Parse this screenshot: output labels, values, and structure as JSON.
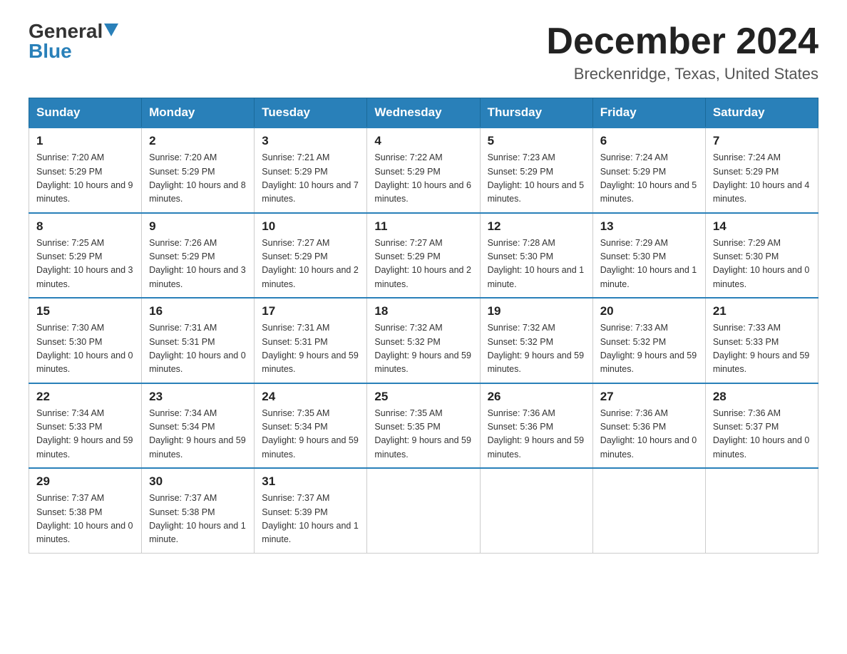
{
  "header": {
    "logo_general": "General",
    "logo_blue": "Blue",
    "month_title": "December 2024",
    "location": "Breckenridge, Texas, United States"
  },
  "days_of_week": [
    "Sunday",
    "Monday",
    "Tuesday",
    "Wednesday",
    "Thursday",
    "Friday",
    "Saturday"
  ],
  "weeks": [
    [
      {
        "day": "1",
        "sunrise": "7:20 AM",
        "sunset": "5:29 PM",
        "daylight": "10 hours and 9 minutes."
      },
      {
        "day": "2",
        "sunrise": "7:20 AM",
        "sunset": "5:29 PM",
        "daylight": "10 hours and 8 minutes."
      },
      {
        "day": "3",
        "sunrise": "7:21 AM",
        "sunset": "5:29 PM",
        "daylight": "10 hours and 7 minutes."
      },
      {
        "day": "4",
        "sunrise": "7:22 AM",
        "sunset": "5:29 PM",
        "daylight": "10 hours and 6 minutes."
      },
      {
        "day": "5",
        "sunrise": "7:23 AM",
        "sunset": "5:29 PM",
        "daylight": "10 hours and 5 minutes."
      },
      {
        "day": "6",
        "sunrise": "7:24 AM",
        "sunset": "5:29 PM",
        "daylight": "10 hours and 5 minutes."
      },
      {
        "day": "7",
        "sunrise": "7:24 AM",
        "sunset": "5:29 PM",
        "daylight": "10 hours and 4 minutes."
      }
    ],
    [
      {
        "day": "8",
        "sunrise": "7:25 AM",
        "sunset": "5:29 PM",
        "daylight": "10 hours and 3 minutes."
      },
      {
        "day": "9",
        "sunrise": "7:26 AM",
        "sunset": "5:29 PM",
        "daylight": "10 hours and 3 minutes."
      },
      {
        "day": "10",
        "sunrise": "7:27 AM",
        "sunset": "5:29 PM",
        "daylight": "10 hours and 2 minutes."
      },
      {
        "day": "11",
        "sunrise": "7:27 AM",
        "sunset": "5:29 PM",
        "daylight": "10 hours and 2 minutes."
      },
      {
        "day": "12",
        "sunrise": "7:28 AM",
        "sunset": "5:30 PM",
        "daylight": "10 hours and 1 minute."
      },
      {
        "day": "13",
        "sunrise": "7:29 AM",
        "sunset": "5:30 PM",
        "daylight": "10 hours and 1 minute."
      },
      {
        "day": "14",
        "sunrise": "7:29 AM",
        "sunset": "5:30 PM",
        "daylight": "10 hours and 0 minutes."
      }
    ],
    [
      {
        "day": "15",
        "sunrise": "7:30 AM",
        "sunset": "5:30 PM",
        "daylight": "10 hours and 0 minutes."
      },
      {
        "day": "16",
        "sunrise": "7:31 AM",
        "sunset": "5:31 PM",
        "daylight": "10 hours and 0 minutes."
      },
      {
        "day": "17",
        "sunrise": "7:31 AM",
        "sunset": "5:31 PM",
        "daylight": "9 hours and 59 minutes."
      },
      {
        "day": "18",
        "sunrise": "7:32 AM",
        "sunset": "5:32 PM",
        "daylight": "9 hours and 59 minutes."
      },
      {
        "day": "19",
        "sunrise": "7:32 AM",
        "sunset": "5:32 PM",
        "daylight": "9 hours and 59 minutes."
      },
      {
        "day": "20",
        "sunrise": "7:33 AM",
        "sunset": "5:32 PM",
        "daylight": "9 hours and 59 minutes."
      },
      {
        "day": "21",
        "sunrise": "7:33 AM",
        "sunset": "5:33 PM",
        "daylight": "9 hours and 59 minutes."
      }
    ],
    [
      {
        "day": "22",
        "sunrise": "7:34 AM",
        "sunset": "5:33 PM",
        "daylight": "9 hours and 59 minutes."
      },
      {
        "day": "23",
        "sunrise": "7:34 AM",
        "sunset": "5:34 PM",
        "daylight": "9 hours and 59 minutes."
      },
      {
        "day": "24",
        "sunrise": "7:35 AM",
        "sunset": "5:34 PM",
        "daylight": "9 hours and 59 minutes."
      },
      {
        "day": "25",
        "sunrise": "7:35 AM",
        "sunset": "5:35 PM",
        "daylight": "9 hours and 59 minutes."
      },
      {
        "day": "26",
        "sunrise": "7:36 AM",
        "sunset": "5:36 PM",
        "daylight": "9 hours and 59 minutes."
      },
      {
        "day": "27",
        "sunrise": "7:36 AM",
        "sunset": "5:36 PM",
        "daylight": "10 hours and 0 minutes."
      },
      {
        "day": "28",
        "sunrise": "7:36 AM",
        "sunset": "5:37 PM",
        "daylight": "10 hours and 0 minutes."
      }
    ],
    [
      {
        "day": "29",
        "sunrise": "7:37 AM",
        "sunset": "5:38 PM",
        "daylight": "10 hours and 0 minutes."
      },
      {
        "day": "30",
        "sunrise": "7:37 AM",
        "sunset": "5:38 PM",
        "daylight": "10 hours and 1 minute."
      },
      {
        "day": "31",
        "sunrise": "7:37 AM",
        "sunset": "5:39 PM",
        "daylight": "10 hours and 1 minute."
      },
      null,
      null,
      null,
      null
    ]
  ]
}
